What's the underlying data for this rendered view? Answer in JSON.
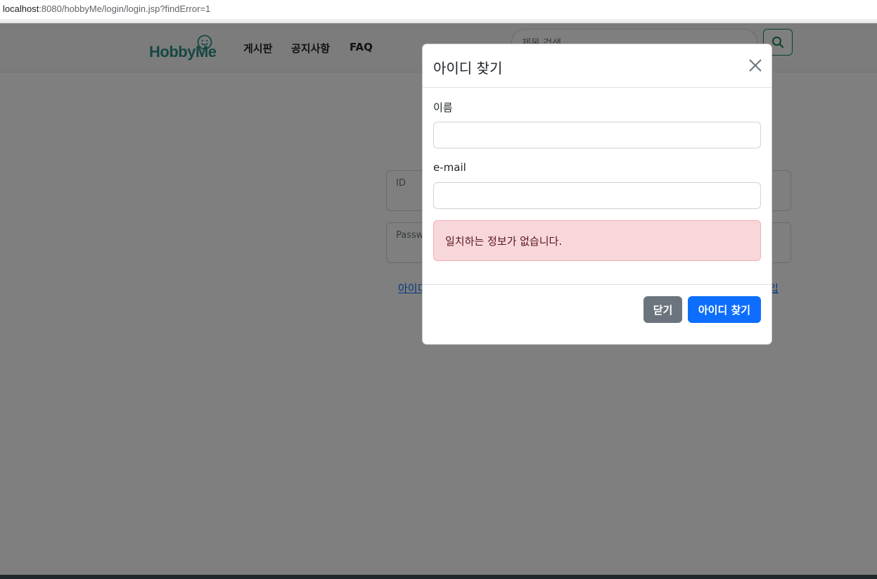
{
  "browser": {
    "url_host": "localhost",
    "url_rest": ":8080/hobbyMe/login/login.jsp?findError=1"
  },
  "header": {
    "logo_text": "HobbyMe",
    "nav": [
      "게시판",
      "공지사항",
      "FAQ"
    ],
    "search_placeholder": "제목 검색"
  },
  "login": {
    "id_label": "ID",
    "password_label": "Password",
    "link_left": "아이디",
    "link_right": "입"
  },
  "modal": {
    "title": "아이디 찾기",
    "name_label": "이름",
    "email_label": "e-mail",
    "name_value": "",
    "email_value": "",
    "error_message": "일치하는 정보가 없습니다.",
    "close_button": "닫기",
    "submit_button": "아이디 찾기"
  },
  "colors": {
    "primary": "#0d6efd",
    "secondary": "#6c757d",
    "danger_bg": "#f8d7da",
    "brand": "#2f8f86"
  }
}
